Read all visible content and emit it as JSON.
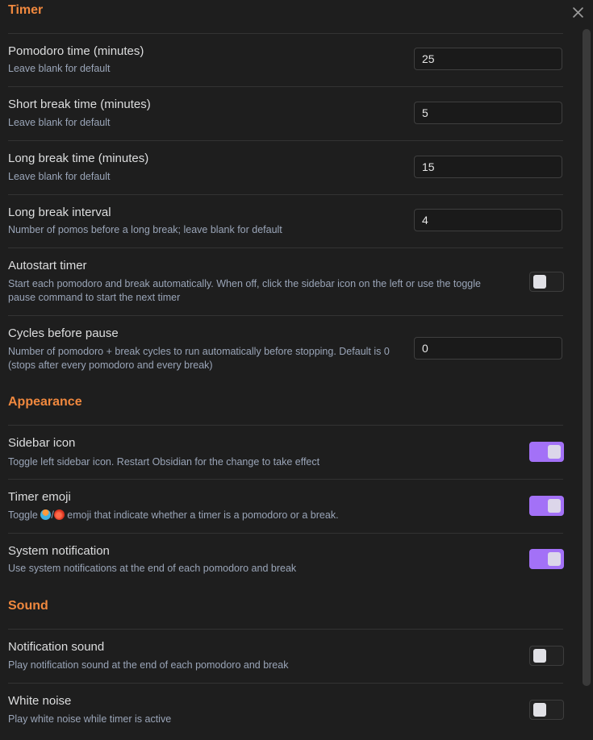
{
  "sections": {
    "timer": "Timer",
    "appearance": "Appearance",
    "sound": "Sound"
  },
  "timer": {
    "pomodoro_time": {
      "title": "Pomodoro time (minutes)",
      "desc": "Leave blank for default",
      "value": "25"
    },
    "short_break": {
      "title": "Short break time (minutes)",
      "desc": "Leave blank for default",
      "value": "5"
    },
    "long_break": {
      "title": "Long break time (minutes)",
      "desc": "Leave blank for default",
      "value": "15"
    },
    "long_break_interval": {
      "title": "Long break interval",
      "desc": "Number of pomos before a long break; leave blank for default",
      "value": "4"
    },
    "autostart": {
      "title": "Autostart timer",
      "desc": "Start each pomodoro and break automatically. When off, click the sidebar icon on the left or use the toggle pause command to start the next timer",
      "enabled": false
    },
    "cycles": {
      "title": "Cycles before pause",
      "desc": "Number of pomodoro + break cycles to run automatically before stopping. Default is 0 (stops after every pomodoro and every break)",
      "value": "0"
    }
  },
  "appearance": {
    "sidebar_icon": {
      "title": "Sidebar icon",
      "desc": "Toggle left sidebar icon. Restart Obsidian for the change to take effect",
      "enabled": true
    },
    "timer_emoji": {
      "title": "Timer emoji",
      "desc_prefix": "Toggle ",
      "desc_sep": "/",
      "desc_suffix": " emoji that indicate whether a timer is a pomodoro or a break.",
      "emoji_1": "beach-umbrella-emoji",
      "emoji_2": "tomato-emoji",
      "enabled": true
    },
    "system_notification": {
      "title": "System notification",
      "desc": "Use system notifications at the end of each pomodoro and break",
      "enabled": true
    }
  },
  "sound": {
    "notification_sound": {
      "title": "Notification sound",
      "desc": "Play notification sound at the end of each pomodoro and break",
      "enabled": false
    },
    "white_noise": {
      "title": "White noise",
      "desc": "Play white noise while timer is active",
      "enabled": false
    }
  },
  "icons": {
    "close": "close-icon"
  },
  "colors": {
    "accent": "#a371f7",
    "heading": "#f0883e",
    "background": "#1e1e1e",
    "description": "#9aa5b8"
  }
}
